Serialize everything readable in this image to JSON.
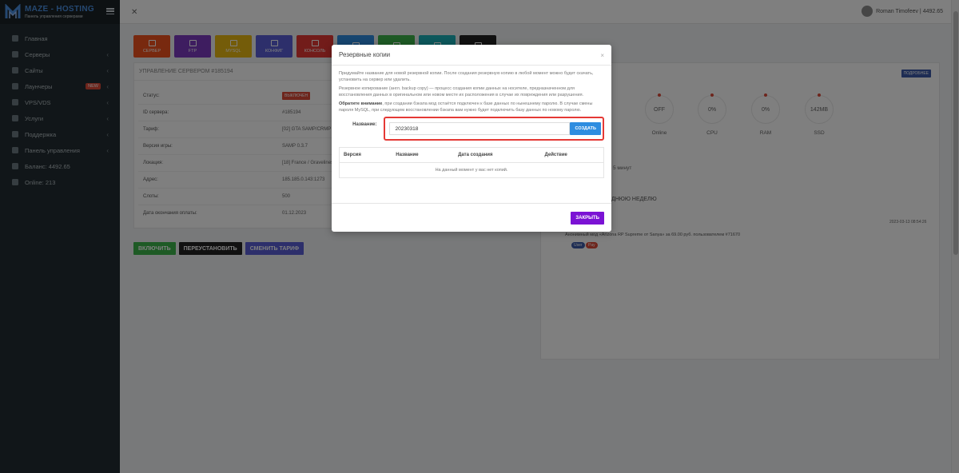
{
  "brand": {
    "name": "MAZE - HOSTING",
    "subtitle": "Панель управления серверами"
  },
  "sidebar": {
    "items": [
      {
        "label": "Главная",
        "arrow": ""
      },
      {
        "label": "Серверы",
        "arrow": "‹"
      },
      {
        "label": "Сайты",
        "arrow": "‹"
      },
      {
        "label": "Лаунчеры",
        "arrow": "‹",
        "badge": "NEW"
      },
      {
        "label": "VPS/VDS",
        "arrow": "‹"
      },
      {
        "label": "Услуги",
        "arrow": "‹"
      },
      {
        "label": "Поддержка",
        "arrow": "‹"
      },
      {
        "label": "Панель управления",
        "arrow": "‹"
      },
      {
        "label": "Баланс: 4492.65",
        "arrow": ""
      },
      {
        "label": "Online: 213",
        "arrow": ""
      }
    ]
  },
  "topbar": {
    "user": "Roman Timofeev | 4492.65"
  },
  "toolbar": {
    "buttons": [
      {
        "label": "СЕРВЕР",
        "color": "#f0521f"
      },
      {
        "label": "FTP",
        "color": "#7d3ac1"
      },
      {
        "label": "MYSQL",
        "color": "#e8b813"
      },
      {
        "label": "КОНФИГ",
        "color": "#5a5fd6"
      },
      {
        "label": "КОНСОЛЬ",
        "color": "#e53935"
      },
      {
        "label": "",
        "color": "#2e8de0"
      },
      {
        "label": "",
        "color": "#3cb54a"
      },
      {
        "label": "",
        "color": "#1ab1b9"
      },
      {
        "label": "",
        "color": "#222222"
      }
    ]
  },
  "server_panel": {
    "title": "УПРАВЛЕНИЕ СЕРВЕРОМ #185194",
    "rows": [
      {
        "label": "Статус:",
        "value": "ВЫКЛЮЧЕН"
      },
      {
        "label": "ID сервера:",
        "value": "#185194"
      },
      {
        "label": "Тариф:",
        "value": "[02] GTA SAMP/CRMP"
      },
      {
        "label": "Версия игры:",
        "value": "SAMP 0.3.7"
      },
      {
        "label": "Локация:",
        "value": "[18] France / Gravelines"
      },
      {
        "label": "Адрес:",
        "value": "185.185.0.143:1273"
      },
      {
        "label": "Слоты:",
        "value": "500"
      },
      {
        "label": "Дата окончания оплаты:",
        "value": "01.12.2023"
      }
    ]
  },
  "actions": {
    "enable": "ВКЛЮЧИТЬ",
    "reinstall": "ПЕРЕУСТАНОВИТЬ",
    "change_tariff": "СМЕНИТЬ ТАРИФ"
  },
  "right_panel": {
    "badge": "ПОДРОБНЕЕ",
    "gauges": [
      {
        "value": "OFF",
        "label": "Online"
      },
      {
        "value": "0%",
        "label": "CPU"
      },
      {
        "value": "0%",
        "label": "RAM"
      },
      {
        "value": "142MB",
        "label": "SSD"
      }
    ],
    "uptime_text": "5 минут",
    "week_title": "ДНЮЮ НЕДЕЛЮ",
    "event_date": "2023-03-13 08:54:26",
    "event_text": "Анонимный мод «Arizona RP Supreme от Sanya» за 69.00 руб. пользователем #71670",
    "tag_user": "User",
    "tag_pay": "Pay"
  },
  "modal": {
    "title": "Резервные копии",
    "close_x": "×",
    "p1": "Придумайте название для новой резервной копии. После создания резервную копию в любой момент можно будет скачать, установить на сервер или удалить.",
    "p2": "Резервное копирование (англ. backup copy) — процесс создания копии данных на носителе, предназначенном для восстановления данных в оригинальном или новом месте их расположения в случае их повреждения или разрушения.",
    "p3_bold": "Обратите внимание",
    "p3": ", при создании бэкапа мод остаётся подключен к базе данных по нынешнему паролю. В случае смены пароля MySQL, при следующем восстановлении бэкапа вам нужно будет подключить базу данных по новому паролю.",
    "name_label": "Название:",
    "name_value": "20230318",
    "create_button": "СОЗДАТЬ",
    "table_headers": [
      "Версия",
      "Название",
      "Дата создания",
      "Действие"
    ],
    "empty_text": "На данный момент у вас нет копий.",
    "close_button": "ЗАКРЫТЬ"
  }
}
